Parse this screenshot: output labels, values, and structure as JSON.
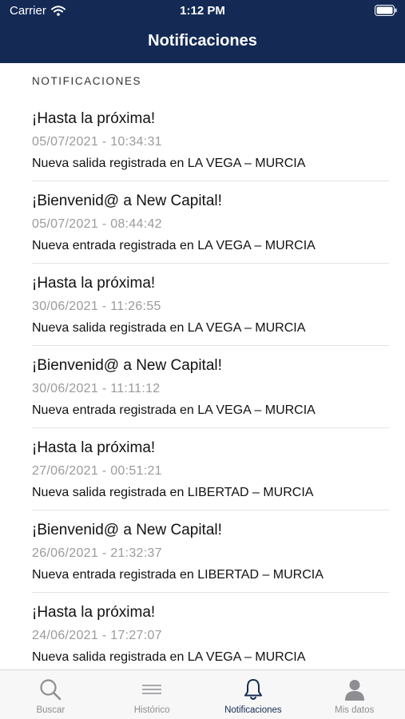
{
  "status_bar": {
    "carrier": "Carrier",
    "time": "1:12 PM"
  },
  "nav": {
    "title": "Notificaciones"
  },
  "section": {
    "header": "NOTIFICACIONES"
  },
  "notifications": [
    {
      "title": "¡Hasta la próxima!",
      "date": "05/07/2021 - 10:34:31",
      "body": "Nueva salida registrada en LA VEGA – MURCIA"
    },
    {
      "title": "¡Bienvenid@ a New Capital!",
      "date": "05/07/2021 - 08:44:42",
      "body": "Nueva entrada registrada en LA VEGA – MURCIA"
    },
    {
      "title": "¡Hasta la próxima!",
      "date": "30/06/2021 - 11:26:55",
      "body": "Nueva salida registrada en LA VEGA – MURCIA"
    },
    {
      "title": "¡Bienvenid@ a New Capital!",
      "date": "30/06/2021 - 11:11:12",
      "body": "Nueva entrada registrada en LA VEGA – MURCIA"
    },
    {
      "title": "¡Hasta la próxima!",
      "date": "27/06/2021 - 00:51:21",
      "body": "Nueva salida registrada en LIBERTAD – MURCIA"
    },
    {
      "title": "¡Bienvenid@ a New Capital!",
      "date": "26/06/2021 - 21:32:37",
      "body": "Nueva entrada registrada en LIBERTAD – MURCIA"
    },
    {
      "title": "¡Hasta la próxima!",
      "date": "24/06/2021 - 17:27:07",
      "body": "Nueva salida registrada en LA VEGA – MURCIA"
    }
  ],
  "tabs": [
    {
      "label": "Buscar",
      "icon": "search-icon",
      "active": false
    },
    {
      "label": "Histórico",
      "icon": "list-icon",
      "active": false
    },
    {
      "label": "Notificaciones",
      "icon": "bell-icon",
      "active": true
    },
    {
      "label": "Mis datos",
      "icon": "person-icon",
      "active": false
    }
  ],
  "colors": {
    "nav_background": "#142a55",
    "active_tab": "#142a55",
    "inactive_tab": "#8e8e93",
    "date_text": "#9b9b9b"
  }
}
